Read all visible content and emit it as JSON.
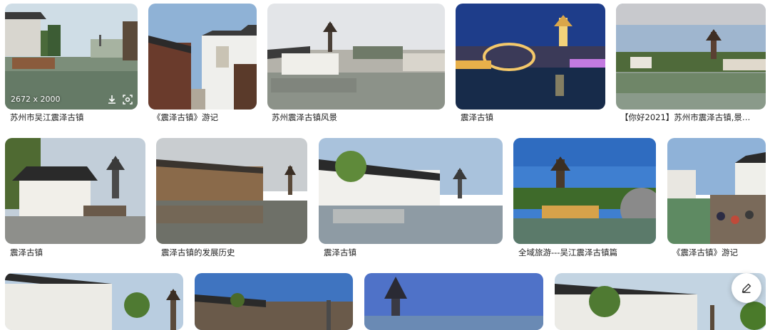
{
  "results": [
    {
      "caption": "苏州市吴江震泽古镇",
      "dimensions": "2672 x 2000"
    },
    {
      "caption": "《震泽古镇》游记"
    },
    {
      "caption": "苏州震泽古镇风景"
    },
    {
      "caption": "震泽古镇"
    },
    {
      "caption": "【你好2021】苏州市震泽古镇,景…"
    },
    {
      "caption": "震泽古镇"
    },
    {
      "caption": "震泽古镇的发展历史"
    },
    {
      "caption": "震泽古镇"
    },
    {
      "caption": "全域旅游---吴江震泽古镇篇"
    },
    {
      "caption": "《震泽古镇》游记"
    },
    {},
    {},
    {},
    {}
  ],
  "overlay_icons": [
    "download-icon",
    "lens-search-icon"
  ],
  "fab_icon": "edit-pencil-icon"
}
